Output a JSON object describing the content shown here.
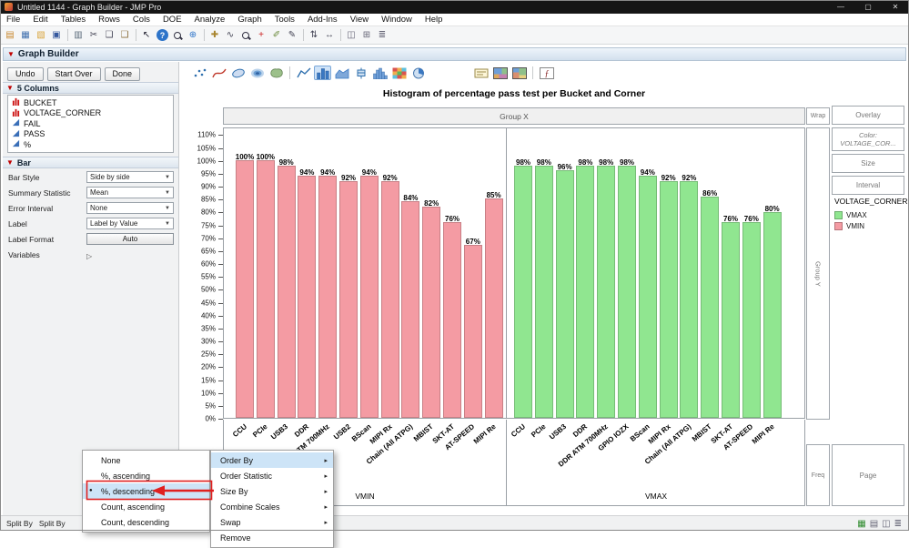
{
  "titlebar": {
    "title": "Untitled 1144 - Graph Builder - JMP Pro",
    "minimize": "—",
    "maximize": "▢",
    "close": "✕"
  },
  "menubar": {
    "items": [
      "File",
      "Edit",
      "Tables",
      "Rows",
      "Cols",
      "DOE",
      "Analyze",
      "Graph",
      "Tools",
      "Add-Ins",
      "View",
      "Window",
      "Help"
    ]
  },
  "toolbar": {
    "icons": [
      {
        "name": "new-journal-icon",
        "glyph": "▤",
        "color": "#c8872c"
      },
      {
        "name": "new-data-table-icon",
        "glyph": "▦",
        "color": "#3f6fae"
      },
      {
        "name": "open-icon",
        "glyph": "▧",
        "color": "#d9a43b"
      },
      {
        "name": "save-icon",
        "glyph": "▣",
        "color": "#35589e",
        "sep_after": true
      },
      {
        "name": "print-icon",
        "glyph": "▥",
        "color": "#5a6a7a"
      },
      {
        "name": "cut-icon",
        "glyph": "✂",
        "color": "#444455"
      },
      {
        "name": "copy-icon",
        "glyph": "❏",
        "color": "#444455"
      },
      {
        "name": "paste-icon",
        "glyph": "❑",
        "color": "#8a6d3b",
        "sep_after": true
      },
      {
        "name": "select-arrow-icon",
        "glyph": "↖",
        "color": "#1a1a2a"
      },
      {
        "name": "help-icon",
        "glyph": "?",
        "round": true
      },
      {
        "name": "search-icon",
        "shape": "magnifier"
      },
      {
        "name": "globe-icon",
        "glyph": "⊕",
        "color": "#2e74c9",
        "sep_after": true
      },
      {
        "name": "grabber-icon",
        "glyph": "✚",
        "color": "#a8852f"
      },
      {
        "name": "lasso-icon",
        "glyph": "∿",
        "color": "#444455"
      },
      {
        "name": "zoom-icon",
        "shape": "magnifier"
      },
      {
        "name": "crosshair-icon",
        "glyph": "+",
        "color": "#cc2222"
      },
      {
        "name": "brush-icon",
        "glyph": "✐",
        "color": "#6a8a3a"
      },
      {
        "name": "annotate-icon",
        "glyph": "✎",
        "color": "#444455",
        "sep_after": true
      },
      {
        "name": "scroller-icon",
        "glyph": "⇅",
        "color": "#444455"
      },
      {
        "name": "resize-icon",
        "glyph": "↔",
        "color": "#444455",
        "sep_after": true
      },
      {
        "name": "journal-icon",
        "glyph": "◫",
        "color": "#666677"
      },
      {
        "name": "layout-icon",
        "glyph": "⊞",
        "color": "#666677"
      },
      {
        "name": "list-icon",
        "glyph": "≣",
        "color": "#666677"
      }
    ]
  },
  "report": {
    "title": "Graph Builder",
    "buttons": [
      "Undo",
      "Start Over",
      "Done"
    ],
    "columns_panel": {
      "title": "5 Columns",
      "columns": [
        {
          "name": "BUCKET",
          "type": "nominal"
        },
        {
          "name": "VOLTAGE_CORNER",
          "type": "nominal"
        },
        {
          "name": "FAIL",
          "type": "continuous"
        },
        {
          "name": "PASS",
          "type": "continuous"
        },
        {
          "name": "%",
          "type": "continuous"
        }
      ]
    },
    "bar_panel": {
      "title": "Bar",
      "rows": [
        {
          "label": "Bar Style",
          "value": "Side by side",
          "control": "select"
        },
        {
          "label": "Summary Statistic",
          "value": "Mean",
          "control": "select"
        },
        {
          "label": "Error Interval",
          "value": "None",
          "control": "select"
        },
        {
          "label": "Label",
          "value": "Label by Value",
          "control": "select"
        },
        {
          "label": "Label Format",
          "value": "Auto",
          "control": "button"
        },
        {
          "label": "Variables",
          "value": "",
          "control": "disclosure"
        }
      ]
    }
  },
  "gb_toolbar": {
    "icons": [
      {
        "name": "points-icon"
      },
      {
        "name": "smoother-icon"
      },
      {
        "name": "ellipse-icon"
      },
      {
        "name": "contour-icon"
      },
      {
        "name": "map-shapes-icon",
        "sep_after": true
      },
      {
        "name": "line-icon"
      },
      {
        "name": "bar-icon",
        "selected": true
      },
      {
        "name": "area-icon"
      },
      {
        "name": "box-plot-icon"
      },
      {
        "name": "histogram-icon"
      },
      {
        "name": "heatmap-icon"
      },
      {
        "name": "pie-icon",
        "gap_after": true
      },
      {
        "name": "caption-box-icon"
      },
      {
        "name": "treemap-icon"
      },
      {
        "name": "mosaic-icon",
        "sep_after": true
      },
      {
        "name": "formula-icon"
      }
    ]
  },
  "chart_data": {
    "type": "bar",
    "title": "Histogram of percentage pass test per Bucket and Corner",
    "group_x_label": "Group X",
    "y_axis": {
      "min": 0,
      "max": 110,
      "step": 5,
      "unit": "%"
    },
    "grid": false,
    "value_labels": true,
    "legend_position": "right",
    "groups": [
      {
        "name": "VMIN",
        "color": "#f49ba3",
        "categories": [
          "CCU",
          "PCIe",
          "USB3",
          "DDR",
          "DDR ATM 700MHz",
          "USB2",
          "BScan",
          "MIPI Rx",
          "Chain (All ATPG)",
          "MBIST",
          "SKT-AT",
          "AT-SPEED",
          "MIPI Re"
        ],
        "values": [
          100,
          100,
          98,
          94,
          94,
          92,
          94,
          92,
          84,
          82,
          76,
          67,
          85
        ]
      },
      {
        "name": "VMAX",
        "color": "#90e690",
        "categories": [
          "CCU",
          "PCIe",
          "USB3",
          "DDR",
          "DDR ATM 700MHz",
          "GPIO IOZX",
          "BScan",
          "MIPI Rx",
          "Chain (All ATPG)",
          "MBIST",
          "SKT-AT",
          "AT-SPEED",
          "MIPI Re"
        ],
        "values": [
          98,
          98,
          96,
          98,
          98,
          98,
          94,
          92,
          92,
          86,
          76,
          76,
          80
        ]
      }
    ]
  },
  "zones": {
    "wrap": "Wrap",
    "overlay": "Overlay",
    "color_title": "Color:",
    "color_value": "VOLTAGE_COR...",
    "size": "Size",
    "interval": "Interval",
    "group_y": "Group Y",
    "freq": "Freq",
    "page": "Page"
  },
  "legend": {
    "title": "VOLTAGE_CORNER",
    "items": [
      {
        "label": "VMAX",
        "color": "#90e690"
      },
      {
        "label": "VMIN",
        "color": "#f49ba3"
      }
    ]
  },
  "context_menus": {
    "order_by_submenu": {
      "items": [
        {
          "label": "None"
        },
        {
          "label": "%, ascending"
        },
        {
          "label": "%, descending",
          "selected": true,
          "highlighted": true
        },
        {
          "label": "Count, ascending"
        },
        {
          "label": "Count, descending"
        }
      ]
    },
    "axis_menu": {
      "items": [
        {
          "label": "Order By",
          "highlighted": true,
          "submenu": true
        },
        {
          "label": "Order Statistic",
          "submenu": true
        },
        {
          "label": "Size By",
          "submenu": true
        },
        {
          "label": "Combine Scales",
          "submenu": true
        },
        {
          "label": "Swap",
          "submenu": true
        },
        {
          "label": "Remove",
          "submenu": false
        }
      ]
    }
  },
  "status_bar": {
    "left_items": [
      "Split By",
      "Split By"
    ],
    "icons": [
      {
        "name": "data-grid-status-icon",
        "glyph": "▦",
        "color": "#2e8b2e"
      },
      {
        "name": "table-status-icon",
        "glyph": "▤",
        "color": "#666677"
      },
      {
        "name": "window-status-icon",
        "glyph": "◫",
        "color": "#666677"
      },
      {
        "name": "list-status-icon",
        "glyph": "≣",
        "color": "#666677"
      }
    ]
  },
  "annotation": {
    "color": "#e02020",
    "target": "%, descending"
  }
}
